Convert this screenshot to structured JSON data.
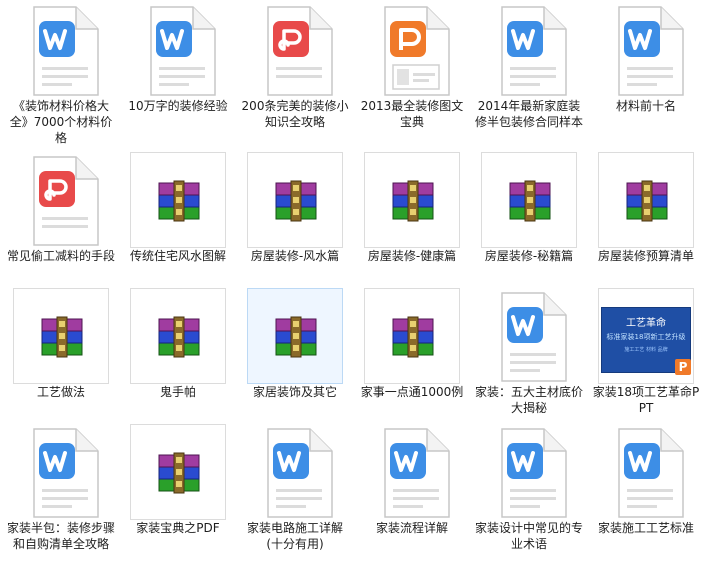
{
  "items": [
    {
      "label": "《装饰材料价格大全》7000个材料价格",
      "type": "word"
    },
    {
      "label": "10万字的装修经验",
      "type": "word"
    },
    {
      "label": "200条完美的装修小知识全攻略",
      "type": "pdf"
    },
    {
      "label": "2013最全装修图文宝典",
      "type": "ppt"
    },
    {
      "label": "2014年最新家庭装修半包装修合同样本",
      "type": "word"
    },
    {
      "label": "材料前十名",
      "type": "word"
    },
    {
      "label": "常见偷工减料的手段",
      "type": "pdf"
    },
    {
      "label": "传统住宅风水图解",
      "type": "rar"
    },
    {
      "label": "房屋装修-风水篇",
      "type": "rar"
    },
    {
      "label": "房屋装修-健康篇",
      "type": "rar"
    },
    {
      "label": "房屋装修-秘籍篇",
      "type": "rar"
    },
    {
      "label": "房屋装修预算清单",
      "type": "rar"
    },
    {
      "label": "工艺做法",
      "type": "rar"
    },
    {
      "label": "鬼手帕",
      "type": "rar"
    },
    {
      "label": "家居装饰及其它",
      "type": "rar",
      "selected": true
    },
    {
      "label": "家事一点通1000例",
      "type": "rar"
    },
    {
      "label": "家装：五大主材底价大揭秘",
      "type": "word"
    },
    {
      "label": "家装18项工艺革命PPT",
      "type": "ppt-thumb",
      "thumb_title": "工艺革命",
      "thumb_sub": "标准家装18项新工艺升级",
      "thumb_footer": "施工工艺 材料 品牌"
    },
    {
      "label": "家装半包：装修步骤和自购清单全攻略",
      "type": "word"
    },
    {
      "label": "家装宝典之PDF",
      "type": "rar"
    },
    {
      "label": "家装电路施工详解(十分有用)",
      "type": "word"
    },
    {
      "label": "家装流程详解",
      "type": "word"
    },
    {
      "label": "家装设计中常见的专业术语",
      "type": "word"
    },
    {
      "label": "家装施工工艺标准",
      "type": "word"
    }
  ],
  "colors": {
    "word": "#3d8ee6",
    "pdf": "#e84a4a",
    "ppt": "#f07a2a",
    "rar_purple": "#a03ca0",
    "rar_blue": "#2a4bd0",
    "rar_green": "#2aa02a",
    "ppt_thumb_bg": "#1f4fa5"
  }
}
